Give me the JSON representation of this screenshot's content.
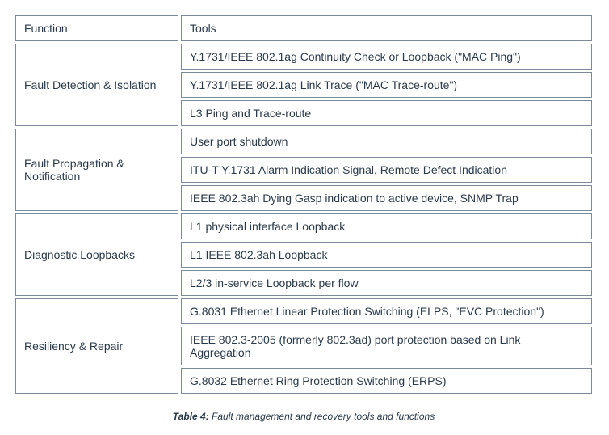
{
  "headers": {
    "function": "Function",
    "tools": "Tools"
  },
  "rows": [
    {
      "function": "Fault Detection & Isolation",
      "tools": [
        "Y.1731/IEEE 802.1ag Continuity Check  or  Loopback (\"MAC Ping\")",
        "Y.1731/IEEE 802.1ag Link Trace (\"MAC Trace-route\")",
        "L3 Ping and Trace-route"
      ]
    },
    {
      "function": "Fault Propagation & Notification",
      "tools": [
        "User port shutdown",
        "ITU-T Y.1731 Alarm Indication Signal, Remote Defect Indication",
        "IEEE 802.3ah Dying Gasp indication to active device, SNMP Trap"
      ]
    },
    {
      "function": "Diagnostic Loopbacks",
      "tools": [
        "L1 physical interface Loopback",
        "L1 IEEE 802.3ah Loopback",
        "L2/3 in-service Loopback per flow"
      ]
    },
    {
      "function": "Resiliency & Repair",
      "tools": [
        "G.8031 Ethernet Linear Protection Switching (ELPS, \"EVC Protection\")",
        "IEEE 802.3-2005 (formerly 802.3ad) port protection based on Link Aggregation",
        "G.8032 Ethernet Ring Protection Switching (ERPS)"
      ]
    }
  ],
  "caption": {
    "label": "Table 4:",
    "text": " Fault management and recovery tools and functions"
  }
}
